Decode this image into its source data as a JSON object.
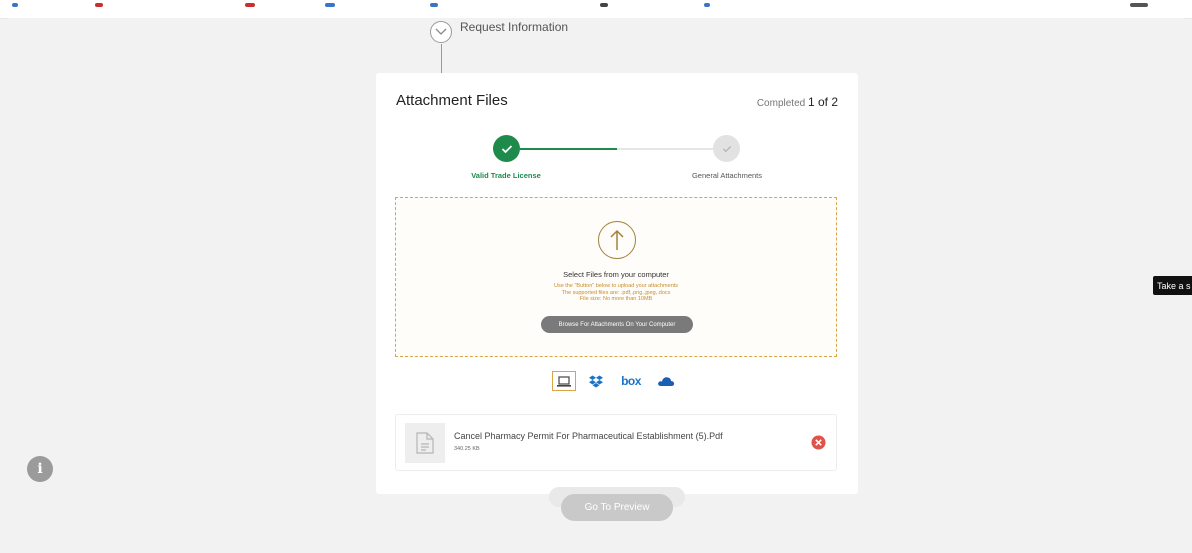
{
  "progress": {
    "request_info_label": "Request Information"
  },
  "card": {
    "title": "Attachment Files",
    "completed_label": "Completed",
    "completed_count": "1 of 2",
    "steps": [
      {
        "label": "Valid Trade License",
        "status": "done"
      },
      {
        "label": "General Attachments",
        "status": "pending"
      }
    ]
  },
  "dropzone": {
    "title": "Select Files from your computer",
    "hint_line1": "Use the \"Button\" below to upload your attachments",
    "hint_line2": "The supported files are: .pdf,.png,.jpeg,.docx",
    "hint_line3": "File size: No more than 10MB",
    "browse_label": "Browse For Attachments On Your Computer"
  },
  "sources": {
    "box_label": "box"
  },
  "file": {
    "name": "Cancel Pharmacy Permit For Pharmaceutical Establishment (5).Pdf",
    "size": "340.25 KB"
  },
  "actions": {
    "preview_label": "Go To Preview"
  },
  "tooltip": {
    "text": "Take a s"
  },
  "colors": {
    "accent_green": "#1e8a4c",
    "accent_gold": "#d9a547",
    "remove_red": "#e0524a"
  }
}
